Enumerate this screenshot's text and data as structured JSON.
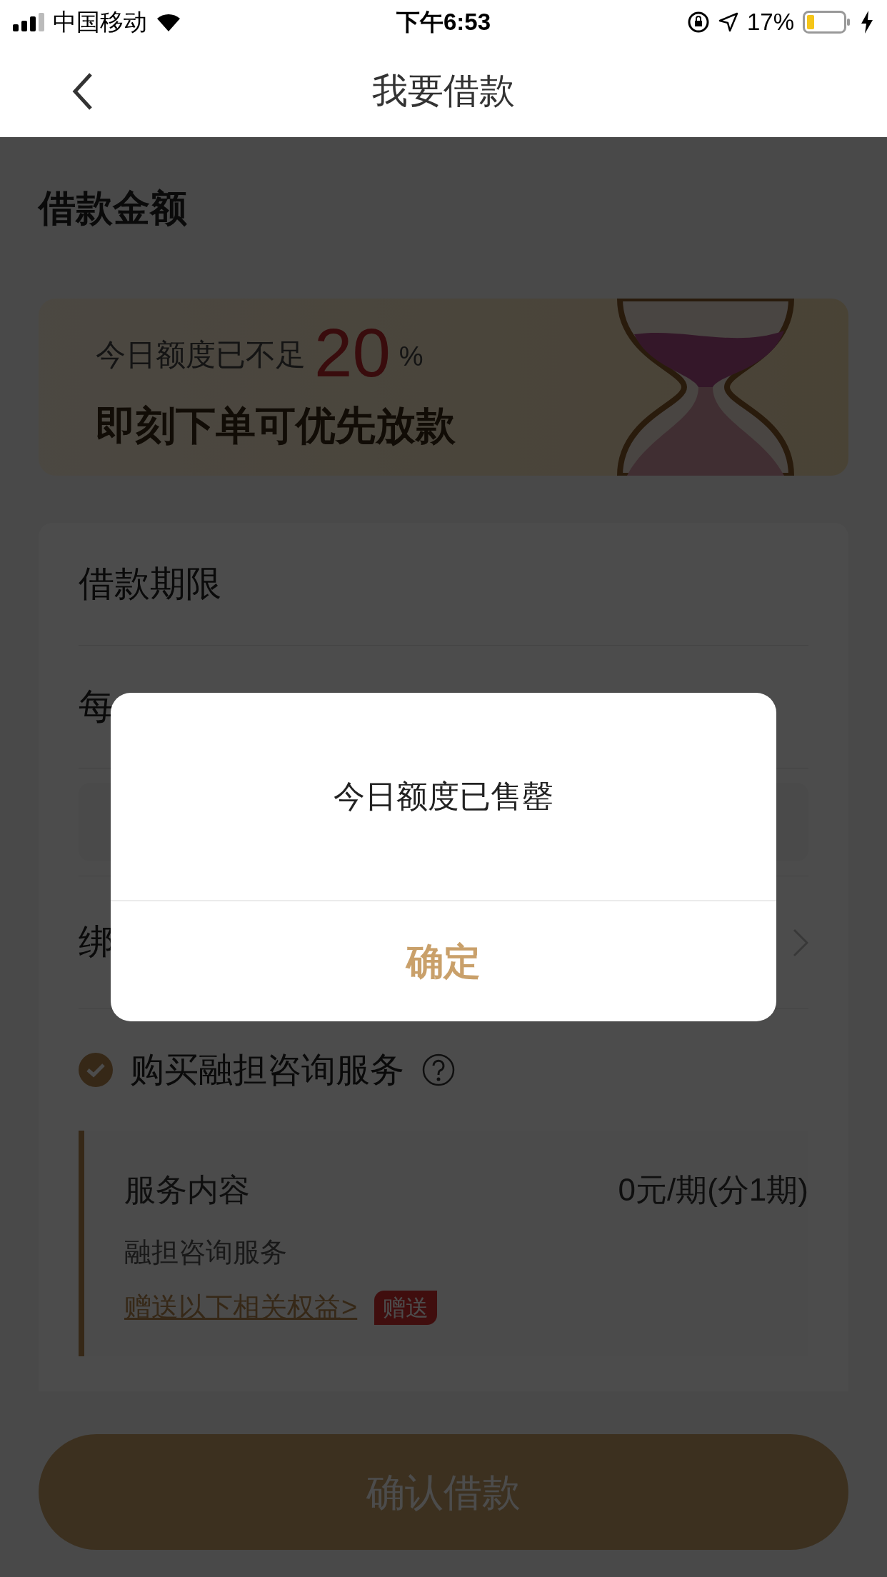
{
  "status_bar": {
    "carrier": "中国移动",
    "time": "下午6:53",
    "battery": "17%"
  },
  "nav": {
    "title": "我要借款"
  },
  "section_title": "借款金额",
  "banner": {
    "line1": "今日额度已不足",
    "percent": "20",
    "percent_sign": "%",
    "line2": "即刻下单可优先放款"
  },
  "form_rows": [
    {
      "kind": "label",
      "label": "借款期限"
    },
    {
      "kind": "label",
      "label": "每"
    },
    {
      "kind": "input"
    },
    {
      "kind": "link",
      "label": "绑"
    }
  ],
  "service": {
    "checked": true,
    "label": "购买融担咨询服务",
    "content_label": "服务内容",
    "price": "0元/期(分1期)",
    "name": "融担咨询服务",
    "link": "赠送以下相关权益>",
    "tag": "赠送"
  },
  "confirm_button": "确认借款",
  "dialog": {
    "message": "今日额度已售罄",
    "button": "确定"
  }
}
